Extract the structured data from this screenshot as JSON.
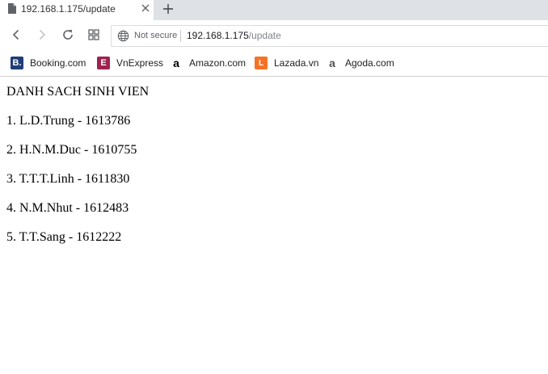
{
  "tab": {
    "title": "192.168.1.175/update",
    "icon": "document-icon"
  },
  "toolbar": {
    "security_label": "Not secure",
    "url_host": "192.168.1.175",
    "url_path": "/update"
  },
  "bookmarks": [
    {
      "label": "Booking.com",
      "icon": "booking-icon",
      "color": "#213d77"
    },
    {
      "label": "VnExpress",
      "icon": "vnexpress-icon",
      "color": "#9f224e"
    },
    {
      "label": "Amazon.com",
      "icon": "amazon-icon",
      "color": "#000000"
    },
    {
      "label": "Lazada.vn",
      "icon": "lazada-icon",
      "color": "#f57224"
    },
    {
      "label": "Agoda.com",
      "icon": "agoda-icon",
      "color": "#555555"
    }
  ],
  "page": {
    "heading": "DANH SACH SINH VIEN",
    "students": [
      "1. L.D.Trung - 1613786",
      "2. H.N.M.Duc - 1610755",
      "3. T.T.T.Linh - 1611830",
      "4. N.M.Nhut - 1612483",
      "5. T.T.Sang - 1612222"
    ]
  }
}
